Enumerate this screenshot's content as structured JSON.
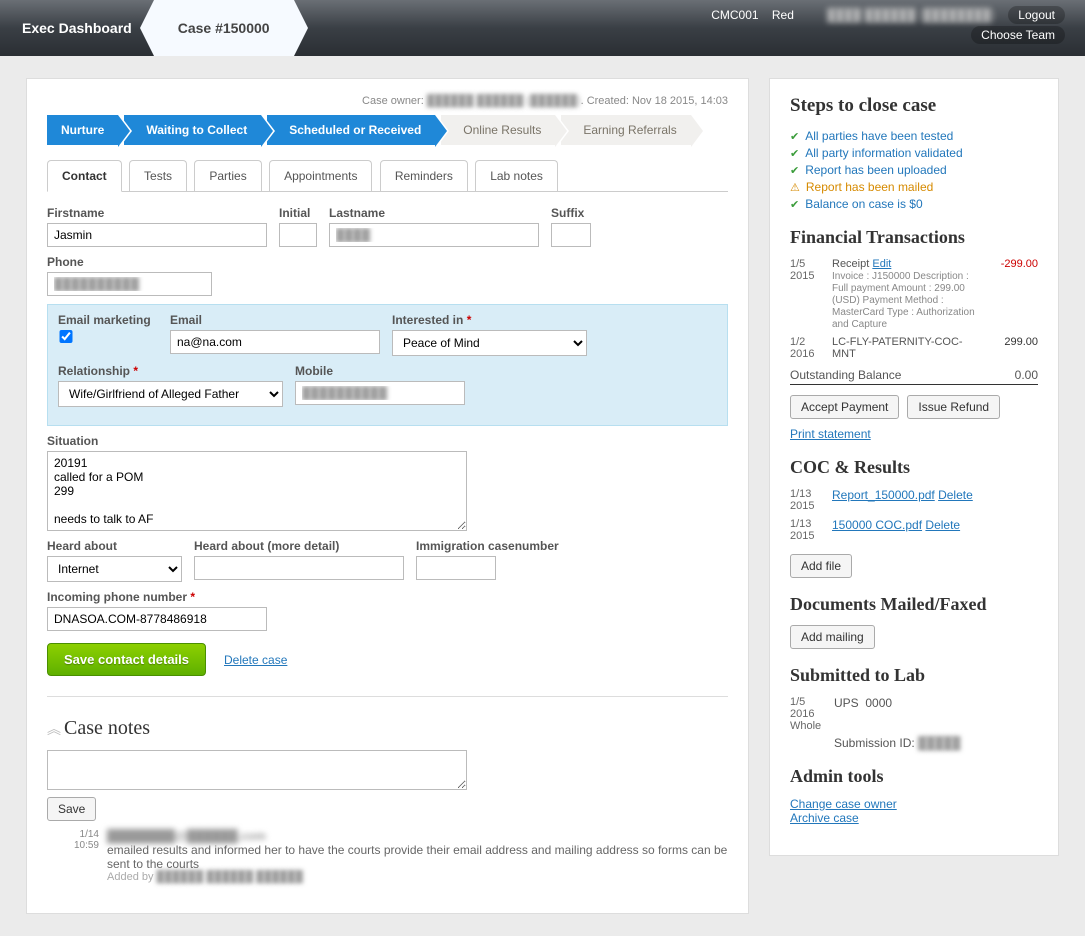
{
  "topbar": {
    "dashboard": "Exec Dashboard",
    "case": "Case #150000",
    "team_code": "CMC001",
    "team_flag": "Red",
    "choose_team": "Choose Team",
    "username": "████ ██████ (████████)",
    "logout": "Logout"
  },
  "meta": {
    "owner_label": "Case owner:",
    "owner_name": "██████ ██████ (██████)",
    "created_label": "Created:",
    "created_value": "Nov 18 2015, 14:03"
  },
  "pipeline": [
    "Nurture",
    "Waiting to Collect",
    "Scheduled or Received",
    "Online Results",
    "Earning Referrals"
  ],
  "tabs": [
    "Contact",
    "Tests",
    "Parties",
    "Appointments",
    "Reminders",
    "Lab notes"
  ],
  "form": {
    "firstname_label": "Firstname",
    "firstname": "Jasmin",
    "initial_label": "Initial",
    "initial": "",
    "lastname_label": "Lastname",
    "lastname": "████",
    "suffix_label": "Suffix",
    "suffix": "",
    "phone_label": "Phone",
    "phone": "██████████",
    "email_mkt_label": "Email marketing",
    "email_label": "Email",
    "email": "na@na.com",
    "interested_label": "Interested in",
    "interested": "Peace of Mind",
    "relationship_label": "Relationship",
    "relationship": "Wife/Girlfriend of Alleged Father",
    "mobile_label": "Mobile",
    "mobile": "██████████",
    "situation_label": "Situation",
    "situation": "20191\ncalled for a POM\n299\n\nneeds to talk to AF",
    "heard_label": "Heard about",
    "heard": "Internet",
    "heard_detail_label": "Heard about (more detail)",
    "heard_detail": "",
    "immigration_label": "Immigration casenumber",
    "immigration": "",
    "incoming_label": "Incoming phone number",
    "incoming": "DNASOA.COM-8778486918",
    "save_btn": "Save contact details",
    "delete_link": "Delete case"
  },
  "notes": {
    "title": "Case notes",
    "save": "Save",
    "entry_date": "1/14",
    "entry_time": "10:59",
    "entry_email": "████████@██████.com",
    "entry_text": "emailed results and informed her to have the courts provide their email address and mailing address so forms can be sent to the courts",
    "added_by_label": "Added by",
    "added_by": "██████ ██████ ██████"
  },
  "side": {
    "steps_title": "Steps to close case",
    "steps": [
      {
        "ok": true,
        "text": "All parties have been tested"
      },
      {
        "ok": true,
        "text": "All party information validated"
      },
      {
        "ok": true,
        "text": "Report has been uploaded"
      },
      {
        "ok": false,
        "text": "Report has been mailed"
      },
      {
        "ok": true,
        "text": "Balance on case is $0"
      }
    ],
    "fin_title": "Financial Transactions",
    "fin": [
      {
        "date": "1/5 2015",
        "label": "Receipt",
        "edit": "Edit",
        "desc": "Invoice : J150000 Description : Full payment Amount : 299.00 (USD) Payment Method : MasterCard Type : Authorization and Capture",
        "amt": "-299.00",
        "neg": true
      },
      {
        "date": "1/2 2016",
        "label": "LC-FLY-PATERNITY-COC-MNT",
        "amt": "299.00"
      }
    ],
    "outbal_label": "Outstanding Balance",
    "outbal": "0.00",
    "accept": "Accept Payment",
    "refund": "Issue Refund",
    "print": "Print statement",
    "coc_title": "COC & Results",
    "docs": [
      {
        "date": "1/13 2015",
        "name": "Report_150000.pdf",
        "del": "Delete"
      },
      {
        "date": "1/13 2015",
        "name": "150000 COC.pdf",
        "del": "Delete"
      }
    ],
    "addfile": "Add file",
    "mailed_title": "Documents Mailed/Faxed",
    "addmailing": "Add mailing",
    "lab_title": "Submitted to Lab",
    "lab_date": "1/5 2016 Whole",
    "lab_carrier": "UPS",
    "lab_track": "0000",
    "lab_sub_label": "Submission ID:",
    "lab_sub": "█████",
    "admin_title": "Admin tools",
    "admin_change": "Change case owner",
    "admin_archive": "Archive case"
  }
}
